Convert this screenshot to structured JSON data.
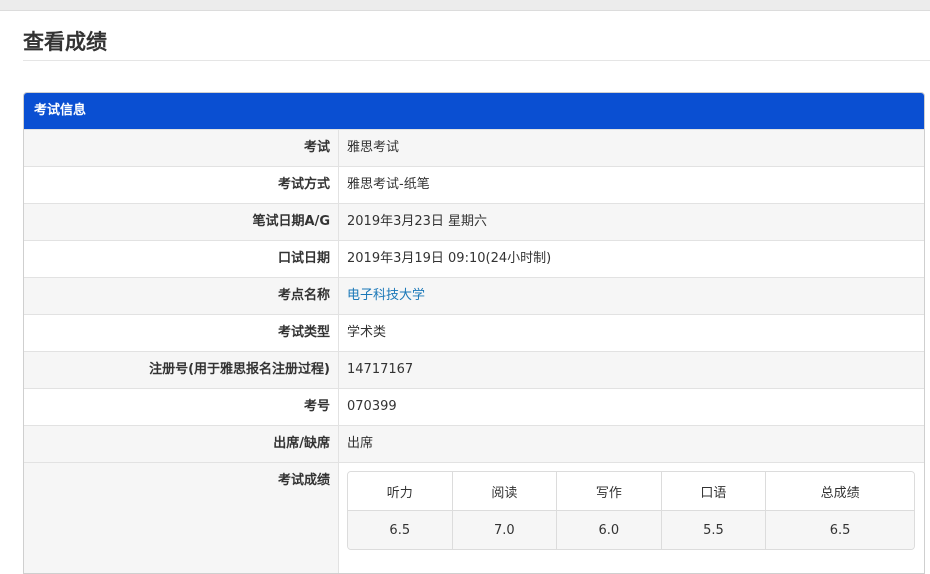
{
  "page": {
    "title": "查看成绩"
  },
  "panel": {
    "header": "考试信息",
    "rows": [
      {
        "label": "考试",
        "value": "雅思考试"
      },
      {
        "label": "考试方式",
        "value": "雅思考试-纸笔"
      },
      {
        "label": "笔试日期A/G",
        "value": "2019年3月23日 星期六"
      },
      {
        "label": "口试日期",
        "value": "2019年3月19日 09:10(24小时制)"
      },
      {
        "label": "考点名称",
        "value": "电子科技大学"
      },
      {
        "label": "考试类型",
        "value": "学术类"
      },
      {
        "label": "注册号(用于雅思报名注册过程)",
        "value": "14717167"
      },
      {
        "label": "考号",
        "value": "070399"
      },
      {
        "label": "出席/缺席",
        "value": "出席"
      }
    ],
    "scores_label": "考试成绩",
    "scores": {
      "headers": [
        "听力",
        "阅读",
        "写作",
        "口语",
        "总成绩"
      ],
      "values": [
        "6.5",
        "7.0",
        "6.0",
        "5.5",
        "6.5"
      ]
    }
  },
  "colors": {
    "header_bg": "#0a4fd2",
    "link": "#1b78b8"
  }
}
